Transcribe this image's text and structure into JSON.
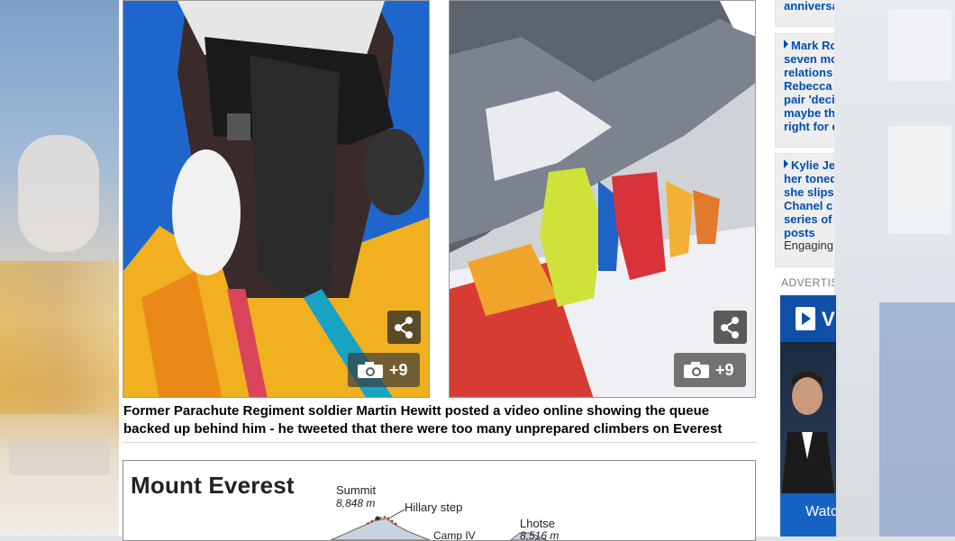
{
  "photos": [
    {
      "count_label": "+9",
      "share_icon": "share-icon",
      "camera_icon": "camera-icon"
    },
    {
      "count_label": "+9",
      "share_icon": "share-icon",
      "camera_icon": "camera-icon"
    }
  ],
  "caption": "Former Parachute Regiment soldier Martin Hewitt posted a video online showing the queue backed up behind him - he tweeted that there were too many unprepared climbers on Everest",
  "infographic": {
    "title": "Mount Everest",
    "labels": {
      "summit": "Summit",
      "summit_height": "8,848 m",
      "hillary_step": "Hillary step",
      "camp": "Camp IV",
      "lhotse": "Lhotse",
      "lhotse_height": "8,516 m"
    }
  },
  "sidebar": {
    "top_link": "anniversa",
    "stories": [
      {
        "lines": [
          "Mark Ro",
          "seven mo",
          "relations",
          "Rebecca",
          "pair 'deci",
          "maybe th",
          "right for e"
        ]
      },
      {
        "lines": [
          "Kylie Je",
          "her toned",
          "she slips",
          "Chanel c",
          "series of",
          "posts"
        ],
        "tag": "Engaging"
      }
    ],
    "ad_label": "ADVERTIS",
    "ad_button_text": "V",
    "ad_watch_text": "Watc"
  },
  "colors": {
    "link": "#004db3",
    "ad_bg": "#123f86"
  }
}
